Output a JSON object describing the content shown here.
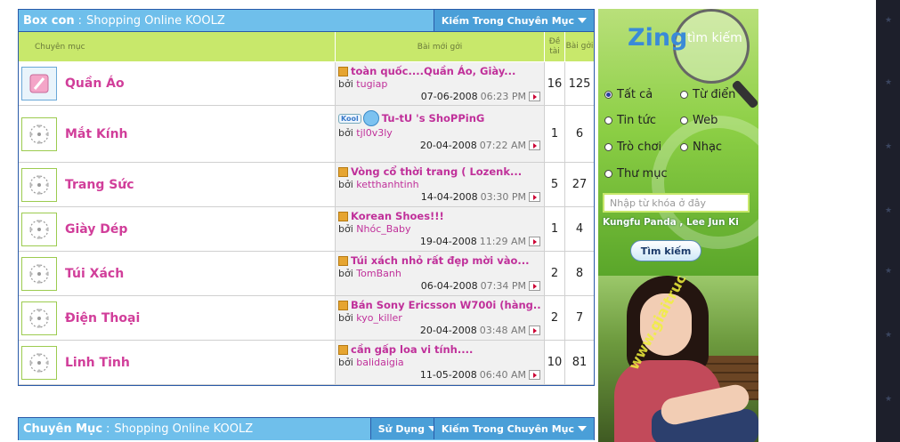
{
  "forum": {
    "header": {
      "prefix": "Box con",
      "separator": ":",
      "title": "Shopping Online KOOLZ",
      "search_menu": "Kiếm Trong Chuyên Mục"
    },
    "columns": {
      "category": "Chuyên mục",
      "last_post": "Bài mới gởi",
      "topics": "Đề tài",
      "posts": "Bài gởi"
    },
    "rows": [
      {
        "name": "Quần Áo",
        "thread": "toàn quốc....Quần Áo, Giày...",
        "by": "bởi",
        "user": "tugiap",
        "date": "07-06-2008",
        "time": "06:23 PM",
        "topics": "16",
        "posts": "125"
      },
      {
        "name": "Mắt Kính",
        "thread": "Tu-tU 's ShoPPinG",
        "by": "bởi",
        "user": "tjl0v3ly",
        "date": "20-04-2008",
        "time": "07:22 AM",
        "topics": "1",
        "posts": "6",
        "avatar_tag": "Kool"
      },
      {
        "name": "Trang Sức",
        "thread": "Vòng cổ thời trang ( Lozenk...",
        "by": "bởi",
        "user": "ketthanhtinh",
        "date": "14-04-2008",
        "time": "03:30 PM",
        "topics": "5",
        "posts": "27"
      },
      {
        "name": "Giày Dép",
        "thread": "Korean Shoes!!!",
        "by": "bởi",
        "user": "Nhóc_Baby",
        "date": "19-04-2008",
        "time": "11:29 AM",
        "topics": "1",
        "posts": "4"
      },
      {
        "name": "Túi Xách",
        "thread": "Túi xách nhỏ rất đẹp mời vào...",
        "by": "bởi",
        "user": "TomBanh",
        "date": "06-04-2008",
        "time": "07:34 PM",
        "topics": "2",
        "posts": "8"
      },
      {
        "name": "Điện Thoại",
        "thread": "Bán Sony Ericsson W700i (hàng...",
        "by": "bởi",
        "user": "kyo_killer",
        "date": "20-04-2008",
        "time": "03:48 AM",
        "topics": "2",
        "posts": "7"
      },
      {
        "name": "Linh Tinh",
        "thread": "cần gấp loa vi tính....",
        "by": "bởi",
        "user": "balidaigia",
        "date": "11-05-2008",
        "time": "06:40 AM",
        "topics": "10",
        "posts": "81"
      }
    ]
  },
  "forum2": {
    "header": {
      "prefix": "Chuyên Mục",
      "separator": ":",
      "title": "Shopping Online KOOLZ",
      "use_menu": "Sử Dụng",
      "search_menu": "Kiếm Trong Chuyên Mục"
    }
  },
  "zing": {
    "logo": "Zing",
    "logo_sub": "tìm kiếm",
    "options": [
      "Tất cả",
      "Từ điển",
      "Tin tức",
      "Web",
      "Trò chơi",
      "Nhạc",
      "Thư mục"
    ],
    "selected": "Tất cả",
    "placeholder": "Nhập từ khóa ở đây",
    "hot_keywords": "Kungfu Panda , Lee Jun Ki",
    "button": "Tìm kiếm"
  },
  "photo_ad": {
    "watermark": "www.giaitruc.info"
  }
}
